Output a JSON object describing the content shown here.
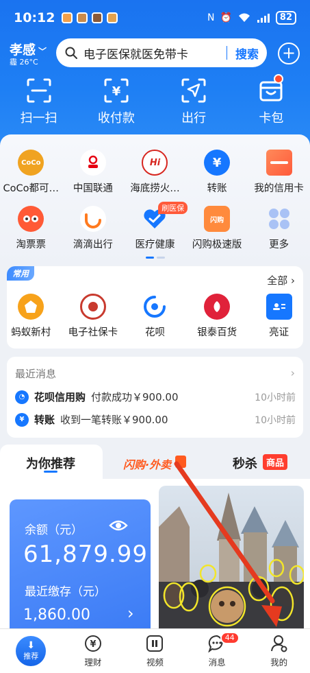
{
  "status_bar": {
    "time": "10:12",
    "battery": "82"
  },
  "header": {
    "city": "孝感",
    "weather": "霾 26°C",
    "search_text": "电子医保就医免带卡",
    "search_button": "搜索",
    "actions": [
      {
        "label": "扫一扫",
        "icon": "scan-icon"
      },
      {
        "label": "收付款",
        "icon": "payment-code-icon"
      },
      {
        "label": "出行",
        "icon": "navigation-icon"
      },
      {
        "label": "卡包",
        "icon": "wallet-icon"
      }
    ]
  },
  "apps_row1": [
    {
      "label": "CoCo都可…",
      "icon": "coco-icon",
      "color": "#f0a321"
    },
    {
      "label": "中国联通",
      "icon": "china-unicom-icon",
      "color": "#e60012"
    },
    {
      "label": "海底捞火…",
      "icon": "haidilao-icon",
      "color": "#d7261f"
    },
    {
      "label": "转账",
      "icon": "transfer-icon",
      "color": "#1677ff"
    },
    {
      "label": "我的信用卡",
      "icon": "credit-card-icon",
      "color": "#ff6b3d"
    }
  ],
  "apps_row2": [
    {
      "label": "淘票票",
      "icon": "taopiaopiao-icon",
      "color": "#ff5a36"
    },
    {
      "label": "滴滴出行",
      "icon": "didi-icon",
      "color": "#ff7a1f"
    },
    {
      "label": "医疗健康",
      "icon": "medical-health-icon",
      "color": "#1677ff",
      "tag": "刷医保"
    },
    {
      "label": "闪购极速版",
      "icon": "shangou-icon",
      "color": "#ff8a3d"
    },
    {
      "label": "更多",
      "icon": "more-icon",
      "color": "#a9c2f5"
    }
  ],
  "common": {
    "tag": "常用",
    "all_label": "全部",
    "items": [
      {
        "label": "蚂蚁新村",
        "icon": "ant-village-icon",
        "color": "#f7a21b"
      },
      {
        "label": "电子社保卡",
        "icon": "social-security-card-icon",
        "color": "#c83a2e"
      },
      {
        "label": "花呗",
        "icon": "huabei-icon",
        "color": "#1677ff"
      },
      {
        "label": "银泰百货",
        "icon": "intime-icon",
        "color": "#e0223a"
      },
      {
        "label": "亮证",
        "icon": "id-card-icon",
        "color": "#1677ff"
      }
    ]
  },
  "messages": {
    "title": "最近消息",
    "items": [
      {
        "name": "花呗信用购",
        "desc": "付款成功￥900.00",
        "time": "10小时前"
      },
      {
        "name": "转账",
        "desc": "收到一笔转账￥900.00",
        "time": "10小时前"
      }
    ]
  },
  "feed_tabs": {
    "recommend": "为你推荐",
    "shangou": "闪购·外卖",
    "seckill": "秒杀",
    "seckill_tag": "商品"
  },
  "balance_card": {
    "balance_label": "余额（元）",
    "balance": "61,879.99",
    "deposit_label": "最近缴存（元）",
    "deposit": "1,860.00"
  },
  "bottom_nav": [
    {
      "label": "推荐",
      "icon": "recommend-icon"
    },
    {
      "label": "理财",
      "icon": "wealth-icon"
    },
    {
      "label": "视频",
      "icon": "video-icon"
    },
    {
      "label": "消息",
      "icon": "message-icon",
      "badge": "44"
    },
    {
      "label": "我的",
      "icon": "profile-icon"
    }
  ],
  "colors": {
    "brand": "#1677ff",
    "header": "#1a73f0",
    "accent_red": "#ff3d2e"
  }
}
